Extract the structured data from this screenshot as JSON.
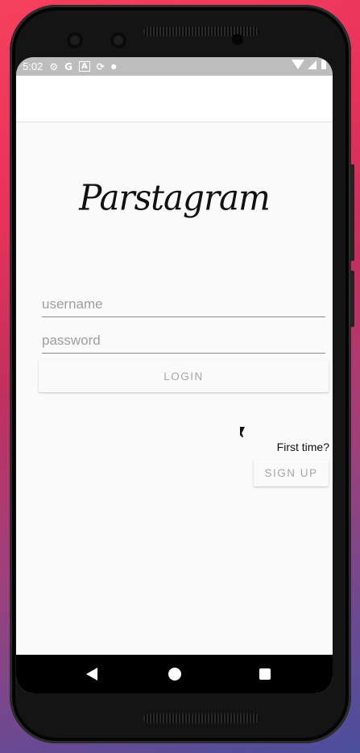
{
  "status_bar": {
    "time": "5:02",
    "icons": [
      "gear-icon",
      "google-g-icon",
      "a-icon",
      "sync-icon",
      "dot-icon",
      "wifi-icon",
      "signal-icon",
      "battery-icon"
    ]
  },
  "app": {
    "logo_text": "Parstagram"
  },
  "login_form": {
    "username_placeholder": "username",
    "password_placeholder": "password",
    "login_label": "LOGIN"
  },
  "signup": {
    "prompt": "First time?",
    "button_label": "SIGN UP"
  },
  "colors": {
    "status_bar": "#bdbdbd",
    "screen_bg": "#fafafa",
    "button_text": "#a6a6a6",
    "nav_bar": "#000000"
  }
}
